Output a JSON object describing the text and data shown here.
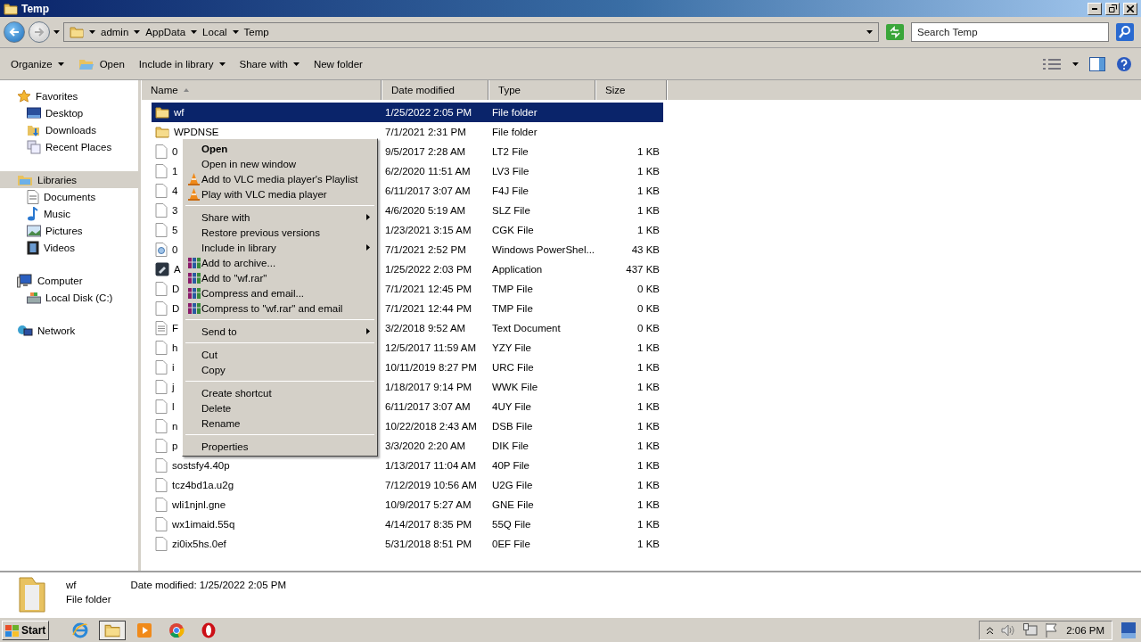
{
  "window": {
    "title": "Temp"
  },
  "address": {
    "crumbs": [
      "admin",
      "AppData",
      "Local",
      "Temp"
    ]
  },
  "search": {
    "placeholder": "Search Temp"
  },
  "toolbar": [
    {
      "label": "Organize",
      "kind": "dropdown"
    },
    {
      "label": "Open",
      "kind": "open"
    },
    {
      "label": "Include in library",
      "kind": "dropdown"
    },
    {
      "label": "Share with",
      "kind": "dropdown"
    },
    {
      "label": "New folder",
      "kind": "plain"
    }
  ],
  "sidebar": [
    {
      "label": "Favorites",
      "kind": "star",
      "selected": false,
      "children": [
        {
          "label": "Desktop",
          "kind": "desktop"
        },
        {
          "label": "Downloads",
          "kind": "downloads"
        },
        {
          "label": "Recent Places",
          "kind": "recent"
        }
      ]
    },
    {
      "label": "Libraries",
      "kind": "library",
      "selected": true,
      "children": [
        {
          "label": "Documents",
          "kind": "document"
        },
        {
          "label": "Music",
          "kind": "music"
        },
        {
          "label": "Pictures",
          "kind": "pictures"
        },
        {
          "label": "Videos",
          "kind": "videos"
        }
      ]
    },
    {
      "label": "Computer",
      "kind": "computer",
      "selected": false,
      "children": [
        {
          "label": "Local Disk (C:)",
          "kind": "disk"
        }
      ]
    },
    {
      "label": "Network",
      "kind": "network",
      "selected": false
    }
  ],
  "columns": [
    {
      "label": "Name",
      "sorted": true
    },
    {
      "label": "Date modified",
      "sorted": false
    },
    {
      "label": "Type",
      "sorted": false
    },
    {
      "label": "Size",
      "sorted": false
    }
  ],
  "rows": [
    {
      "name": "wf",
      "date": "1/25/2022 2:05 PM",
      "type": "File folder",
      "kind": "folder",
      "selected": true
    },
    {
      "name": "WPDNSE",
      "date": "7/1/2021 2:31 PM",
      "type": "File folder",
      "kind": "folder",
      "selected": false
    },
    {
      "name": "0",
      "date": "9/5/2017 2:28 AM",
      "type": "LT2 File",
      "size": "1 KB",
      "kind": "file",
      "selected": false
    },
    {
      "name": "1",
      "date": "6/2/2020 11:51 AM",
      "type": "LV3 File",
      "size": "1 KB",
      "kind": "file",
      "selected": false
    },
    {
      "name": "4",
      "date": "6/11/2017 3:07 AM",
      "type": "F4J File",
      "size": "1 KB",
      "kind": "file",
      "selected": false
    },
    {
      "name": "3",
      "date": "4/6/2020 5:19 AM",
      "type": "SLZ File",
      "size": "1 KB",
      "kind": "file",
      "selected": false
    },
    {
      "name": "5",
      "date": "1/23/2021 3:15 AM",
      "type": "CGK File",
      "size": "1 KB",
      "kind": "file",
      "selected": false
    },
    {
      "name": "0",
      "date": "7/1/2021 2:52 PM",
      "type": "Windows PowerShel...",
      "size": "43 KB",
      "kind": "script",
      "selected": false
    },
    {
      "name": "A",
      "date": "1/25/2022 2:03 PM",
      "type": "Application",
      "size": "437 KB",
      "kind": "app",
      "selected": false
    },
    {
      "name": "D",
      "date": "7/1/2021 12:45 PM",
      "type": "TMP File",
      "size": "0 KB",
      "kind": "file",
      "selected": false
    },
    {
      "name": "D",
      "date": "7/1/2021 12:44 PM",
      "type": "TMP File",
      "size": "0 KB",
      "kind": "file",
      "selected": false
    },
    {
      "name": "F",
      "date": "3/2/2018 9:52 AM",
      "type": "Text Document",
      "size": "0 KB",
      "kind": "text",
      "selected": false
    },
    {
      "name": "h",
      "date": "12/5/2017 11:59 AM",
      "type": "YZY File",
      "size": "1 KB",
      "kind": "file",
      "selected": false
    },
    {
      "name": "i",
      "date": "10/11/2019 8:27 PM",
      "type": "URC File",
      "size": "1 KB",
      "kind": "file",
      "selected": false
    },
    {
      "name": "j",
      "date": "1/18/2017 9:14 PM",
      "type": "WWK File",
      "size": "1 KB",
      "kind": "file",
      "selected": false
    },
    {
      "name": "l",
      "date": "6/11/2017 3:07 AM",
      "type": "4UY File",
      "size": "1 KB",
      "kind": "file",
      "selected": false
    },
    {
      "name": "n",
      "date": "10/22/2018 2:43 AM",
      "type": "DSB File",
      "size": "1 KB",
      "kind": "file",
      "selected": false
    },
    {
      "name": "p",
      "date": "3/3/2020 2:20 AM",
      "type": "DIK File",
      "size": "1 KB",
      "kind": "file",
      "selected": false
    },
    {
      "name": "sostsfy4.40p",
      "date": "1/13/2017 11:04 AM",
      "type": "40P File",
      "size": "1 KB",
      "kind": "file",
      "selected": false
    },
    {
      "name": "tcz4bd1a.u2g",
      "date": "7/12/2019 10:56 AM",
      "type": "U2G File",
      "size": "1 KB",
      "kind": "file",
      "selected": false
    },
    {
      "name": "wli1njnl.gne",
      "date": "10/9/2017 5:27 AM",
      "type": "GNE File",
      "size": "1 KB",
      "kind": "file",
      "selected": false
    },
    {
      "name": "wx1imaid.55q",
      "date": "4/14/2017 8:35 PM",
      "type": "55Q File",
      "size": "1 KB",
      "kind": "file",
      "selected": false
    },
    {
      "name": "zi0ix5hs.0ef",
      "date": "5/31/2018 8:51 PM",
      "type": "0EF File",
      "size": "1 KB",
      "kind": "file",
      "selected": false
    }
  ],
  "context_menu": [
    {
      "kind": "plain",
      "label": "Open",
      "bold": true,
      "submenu": false
    },
    {
      "kind": "plain",
      "label": "Open in new window",
      "bold": false,
      "submenu": false
    },
    {
      "kind": "cone",
      "label": "Add to VLC media player's Playlist",
      "bold": false,
      "submenu": false
    },
    {
      "kind": "cone",
      "label": "Play with VLC media player",
      "bold": false,
      "submenu": false
    },
    {
      "kind": "separator"
    },
    {
      "kind": "plain",
      "label": "Share with",
      "bold": false,
      "submenu": true
    },
    {
      "kind": "plain",
      "label": "Restore previous versions",
      "bold": false,
      "submenu": false
    },
    {
      "kind": "plain",
      "label": "Include in library",
      "bold": false,
      "submenu": true
    },
    {
      "kind": "archive",
      "label": "Add to archive...",
      "bold": false,
      "submenu": false
    },
    {
      "kind": "archive",
      "label": "Add to \"wf.rar\"",
      "bold": false,
      "submenu": false
    },
    {
      "kind": "archive",
      "label": "Compress and email...",
      "bold": false,
      "submenu": false
    },
    {
      "kind": "archive",
      "label": "Compress to \"wf.rar\" and email",
      "bold": false,
      "submenu": false
    },
    {
      "kind": "separator"
    },
    {
      "kind": "plain",
      "label": "Send to",
      "bold": false,
      "submenu": true
    },
    {
      "kind": "separator"
    },
    {
      "kind": "plain",
      "label": "Cut",
      "bold": false,
      "submenu": false
    },
    {
      "kind": "plain",
      "label": "Copy",
      "bold": false,
      "submenu": false
    },
    {
      "kind": "separator"
    },
    {
      "kind": "plain",
      "label": "Create shortcut",
      "bold": false,
      "submenu": false
    },
    {
      "kind": "plain",
      "label": "Delete",
      "bold": false,
      "submenu": false
    },
    {
      "kind": "plain",
      "label": "Rename",
      "bold": false,
      "submenu": false
    },
    {
      "kind": "separator"
    },
    {
      "kind": "plain",
      "label": "Properties",
      "bold": false,
      "submenu": false
    }
  ],
  "details": {
    "name": "wf",
    "date_label": "Date modified:",
    "date": "1/25/2022 2:05 PM",
    "type": "File folder"
  },
  "taskbar": {
    "start": "Start",
    "apps": [
      {
        "kind": "ie",
        "selected": false
      },
      {
        "kind": "explorer",
        "selected": true
      },
      {
        "kind": "media",
        "selected": false
      },
      {
        "kind": "chrome",
        "selected": false
      },
      {
        "kind": "opera",
        "selected": false
      }
    ],
    "clock": "2:06 PM"
  }
}
